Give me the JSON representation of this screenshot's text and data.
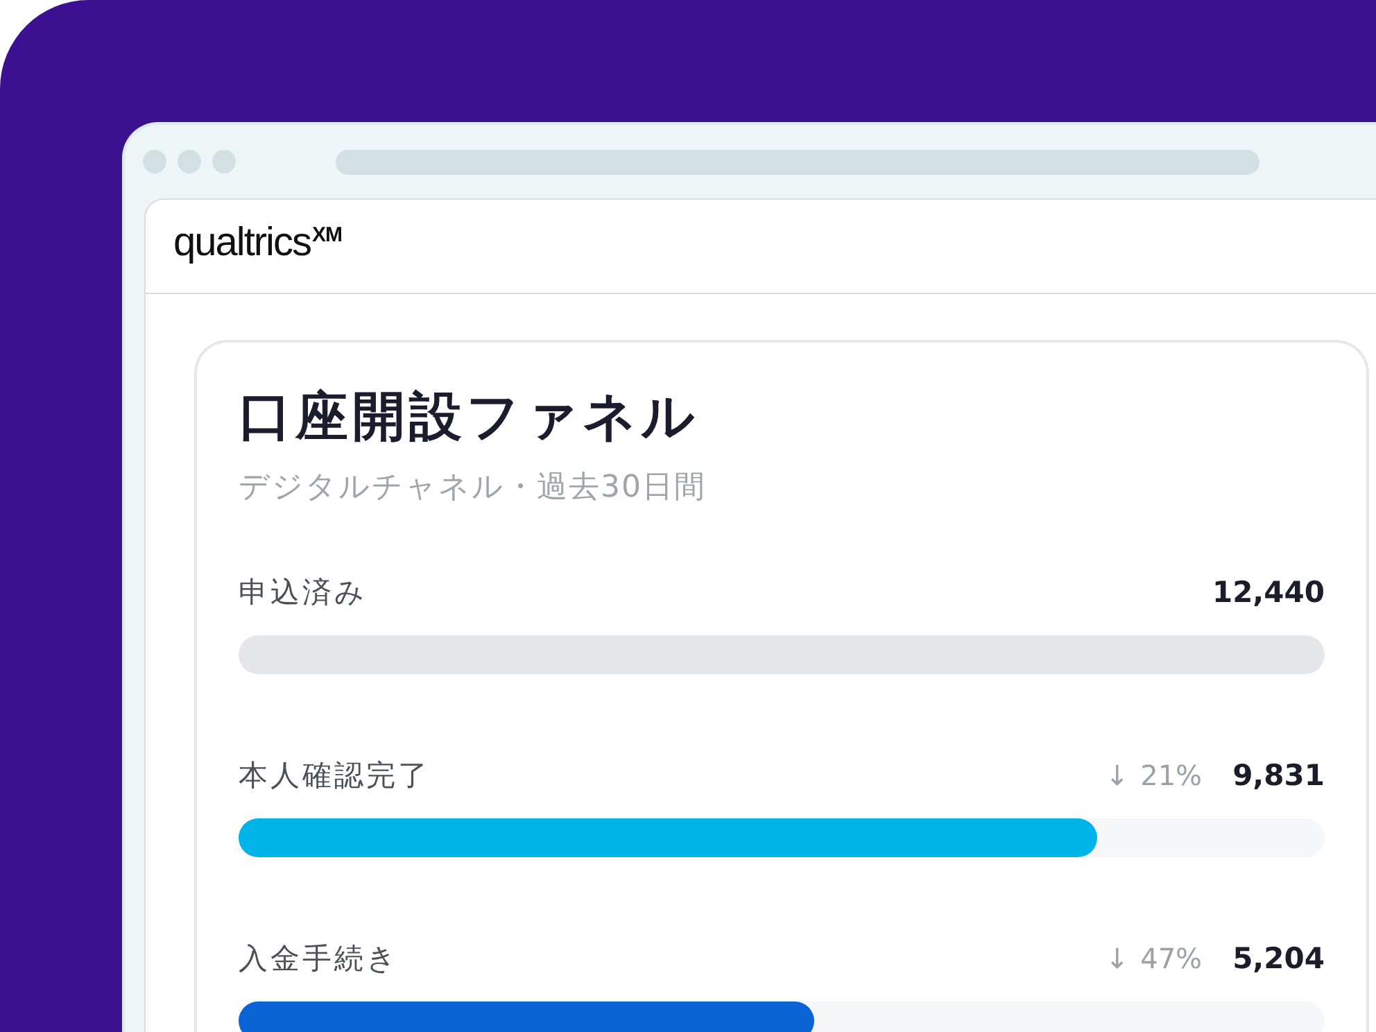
{
  "browser": {
    "logo": "qualtrics$^{XM}$"
  },
  "card": {
    "title": "口座開設ファネル",
    "subtitle": "デジタルチャネル・過去30日間",
    "steps": [
      {
        "kind": "total",
        "label": "申込済み",
        "value": "12,440",
        "color": "#e4e6e9"
      },
      {
        "kind": "step",
        "label": "本人確認完了",
        "change": "↓ 21%",
        "value": "9,831",
        "level": 0.79,
        "color": "#00b4ea"
      },
      {
        "kind": "step",
        "label": "入金手続き",
        "change": "↓ 47%",
        "value": "5,204",
        "level": 0.53,
        "color": "#0b64d6"
      }
    ]
  }
}
